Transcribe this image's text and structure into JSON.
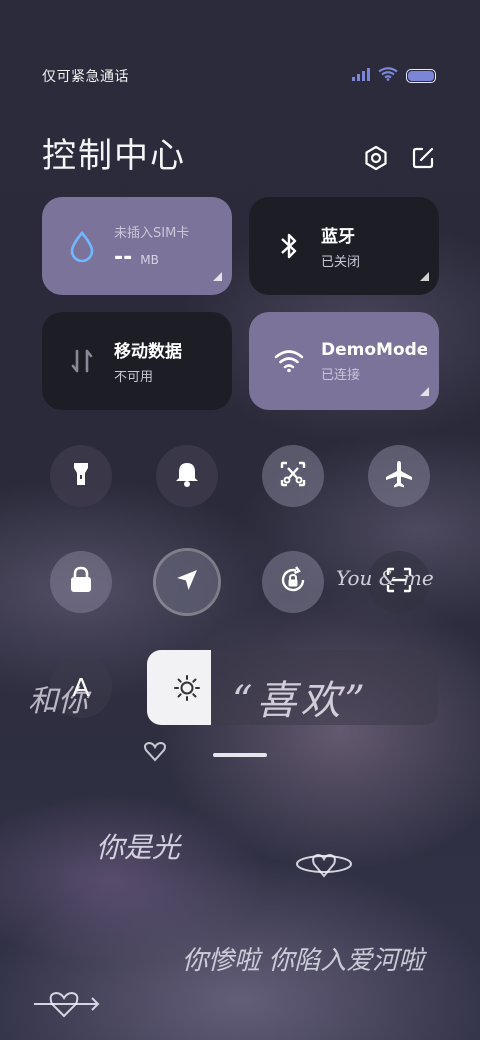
{
  "status": {
    "carrier": "仅可紧急通话",
    "signal_icon": "signal-icon",
    "wifi_icon": "wifi-icon",
    "battery_level": 1.0,
    "battery_color": "#7c86d8"
  },
  "header": {
    "title": "控制中心",
    "settings_icon": "gear-icon",
    "edit_icon": "edit-icon"
  },
  "tiles": {
    "data_usage": {
      "title": "未插入SIM卡",
      "value": "--",
      "unit": "MB",
      "icon": "water-drop-icon",
      "active": true
    },
    "bluetooth": {
      "title": "蓝牙",
      "status": "已关闭",
      "icon": "bluetooth-icon",
      "active": false
    },
    "mobile_data": {
      "title": "移动数据",
      "status": "不可用",
      "icon": "mobile-data-icon",
      "active": false
    },
    "wifi": {
      "title": "DemoMode",
      "status": "已连接",
      "icon": "wifi-icon",
      "active": true
    }
  },
  "quick_toggles": [
    {
      "name": "flashlight-icon"
    },
    {
      "name": "bell-icon"
    },
    {
      "name": "screenshot-icon"
    },
    {
      "name": "airplane-icon"
    },
    {
      "name": "lock-icon"
    },
    {
      "name": "location-icon"
    },
    {
      "name": "rotation-lock-icon"
    },
    {
      "name": "scan-icon"
    }
  ],
  "auto_brightness_label": "A",
  "brightness": {
    "level": 0.22,
    "icon": "sun-icon"
  },
  "wallpaper_text": {
    "you_and_me": "You & me",
    "xihuan": "“喜欢”",
    "ni_shi_guang": "你是光",
    "bottom_line": "你惨啦 你陷入爱河啦",
    "he_ni": "和你"
  },
  "colors": {
    "active_tile": "#7b7399",
    "inactive_tile": "#1d1d26",
    "accent": "#7c86d8"
  }
}
